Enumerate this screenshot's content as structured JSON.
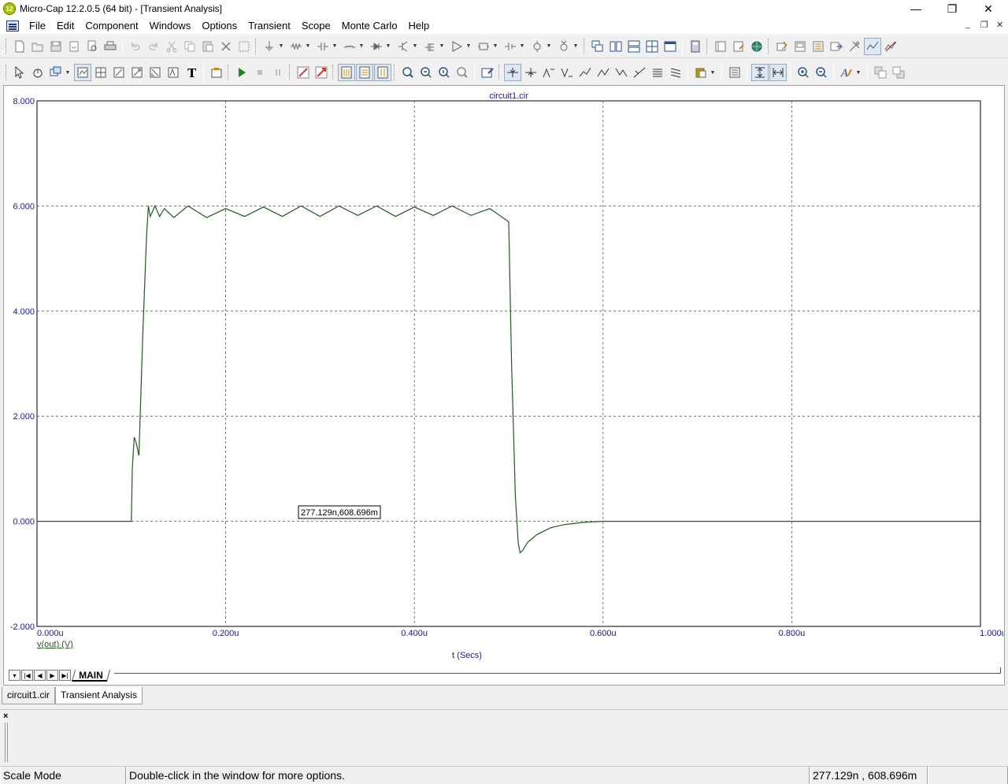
{
  "window": {
    "title": "Micro-Cap 12.2.0.5 (64 bit) - [Transient Analysis]",
    "app_icon_text": "12",
    "minimize": "—",
    "restore": "❐",
    "close": "✕"
  },
  "menu": {
    "items": [
      "File",
      "Edit",
      "Component",
      "Windows",
      "Options",
      "Transient",
      "Scope",
      "Monte Carlo",
      "Help"
    ],
    "mdi_minimize": "_",
    "mdi_restore": "❐",
    "mdi_close": "✕"
  },
  "plot": {
    "title": "circuit1.cir",
    "cursor_readout": "277.129n,608.696m",
    "x_axis_title": "t (Secs)",
    "trace_label": "v(out) (V)",
    "trace_color": "#1d5a1d",
    "axis_text_color": "#1a1a8c"
  },
  "chart_data": {
    "type": "line",
    "title": "circuit1.cir",
    "xlabel": "t (Secs)",
    "ylabel": "",
    "xlim": [
      0,
      1.0
    ],
    "ylim": [
      -2,
      8
    ],
    "x_ticks": [
      "0.000u",
      "0.200u",
      "0.400u",
      "0.600u",
      "0.800u",
      "1.000u"
    ],
    "y_ticks": [
      "8.000",
      "6.000",
      "4.000",
      "2.000",
      "0.000",
      "-2.000"
    ],
    "grid": true,
    "series": [
      {
        "name": "v(out) (V)",
        "x_unit": "us",
        "x": [
          0,
          0.1,
          0.101,
          0.103,
          0.105,
          0.108,
          0.112,
          0.116,
          0.118,
          0.12,
          0.125,
          0.13,
          0.135,
          0.145,
          0.16,
          0.18,
          0.2,
          0.22,
          0.24,
          0.26,
          0.28,
          0.3,
          0.32,
          0.34,
          0.36,
          0.38,
          0.4,
          0.42,
          0.44,
          0.46,
          0.48,
          0.5,
          0.503,
          0.507,
          0.51,
          0.512,
          0.515,
          0.52,
          0.53,
          0.545,
          0.56,
          0.58,
          0.6,
          0.65,
          0.8,
          1.0
        ],
        "y": [
          0,
          0,
          1.0,
          1.6,
          1.5,
          1.25,
          3.5,
          5.4,
          6.0,
          5.8,
          6.0,
          5.8,
          5.95,
          5.78,
          6.0,
          5.78,
          5.95,
          5.8,
          5.98,
          5.8,
          6.0,
          5.8,
          6.0,
          5.82,
          6.0,
          5.8,
          5.98,
          5.82,
          6.0,
          5.82,
          5.95,
          5.7,
          3.0,
          0.5,
          -0.4,
          -0.6,
          -0.55,
          -0.4,
          -0.25,
          -0.12,
          -0.06,
          -0.02,
          0,
          0,
          0,
          0
        ]
      }
    ]
  },
  "plot_tabs": {
    "nav": [
      "▾",
      "|◀",
      "◀",
      "▶",
      "▶|"
    ],
    "main": "MAIN"
  },
  "doc_tabs": [
    "circuit1.cir",
    "Transient Analysis"
  ],
  "output": {
    "close": "×"
  },
  "status": {
    "mode": "Scale Mode",
    "hint": "Double-click in the window for more options.",
    "coords": "277.129n , 608.696m",
    "extra": ""
  }
}
